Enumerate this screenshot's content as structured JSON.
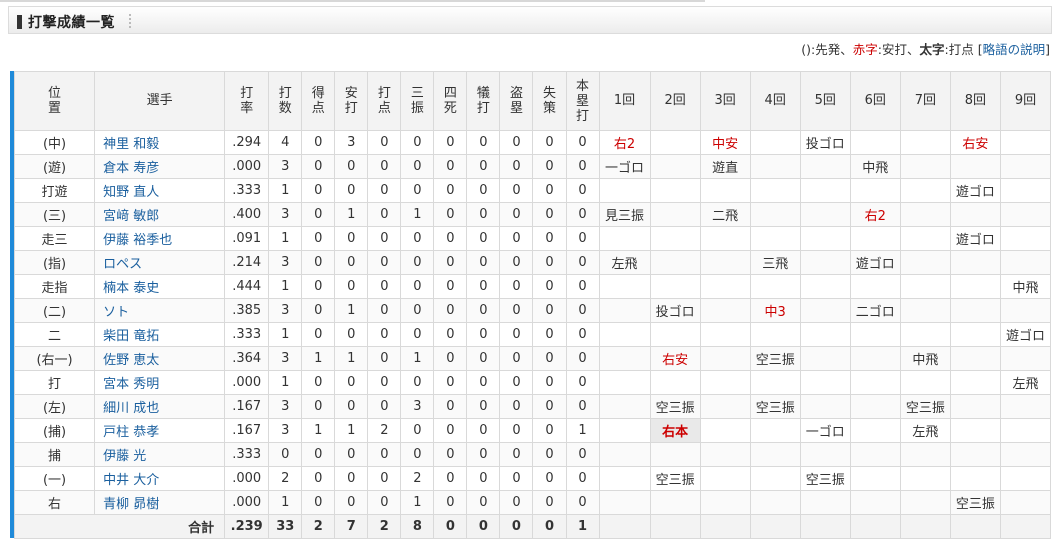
{
  "page": {
    "title": "打撃成績一覧",
    "legend": {
      "part1": "():先発、",
      "red": "赤字",
      "part2": ":安打、",
      "bold": "太字",
      "part3": ":打点 ",
      "bracket_open": "[",
      "link": "略語の説明",
      "bracket_close": "]"
    }
  },
  "colors": {
    "accent": "#1f8ad9",
    "hit": "#cc0000",
    "link": "#1a5f9e"
  },
  "table": {
    "headers": {
      "pos": [
        "位",
        "置"
      ],
      "player": "選手",
      "avg": [
        "打",
        "率"
      ],
      "ab": [
        "打",
        "数"
      ],
      "runs": [
        "得",
        "点"
      ],
      "hits": [
        "安",
        "打"
      ],
      "rbi": [
        "打",
        "点"
      ],
      "so": [
        "三",
        "振"
      ],
      "bb": [
        "四",
        "死"
      ],
      "sac": [
        "犠",
        "打"
      ],
      "sb": [
        "盗",
        "塁"
      ],
      "err": [
        "失",
        "策"
      ],
      "hr": [
        "本",
        "塁",
        "打"
      ],
      "innings": [
        "1回",
        "2回",
        "3回",
        "4回",
        "5回",
        "6回",
        "7回",
        "8回",
        "9回"
      ]
    },
    "rows": [
      {
        "pos": "(中)",
        "name": "神里 和毅",
        "avg": ".294",
        "ab": "4",
        "r": "0",
        "h": "3",
        "rbi": "0",
        "so": "0",
        "bb": "0",
        "sac": "0",
        "sb": "0",
        "e": "0",
        "hr": "0",
        "inn": [
          {
            "t": "右2",
            "k": "hit"
          },
          {
            "t": "",
            "k": ""
          },
          {
            "t": "中安",
            "k": "hit"
          },
          {
            "t": "",
            "k": ""
          },
          {
            "t": "投ゴロ",
            "k": ""
          },
          {
            "t": "",
            "k": ""
          },
          {
            "t": "",
            "k": ""
          },
          {
            "t": "右安",
            "k": "hit"
          },
          {
            "t": "",
            "k": ""
          }
        ]
      },
      {
        "pos": "(遊)",
        "name": "倉本 寿彦",
        "avg": ".000",
        "ab": "3",
        "r": "0",
        "h": "0",
        "rbi": "0",
        "so": "0",
        "bb": "0",
        "sac": "0",
        "sb": "0",
        "e": "0",
        "hr": "0",
        "inn": [
          {
            "t": "一ゴロ",
            "k": ""
          },
          {
            "t": "",
            "k": ""
          },
          {
            "t": "遊直",
            "k": ""
          },
          {
            "t": "",
            "k": ""
          },
          {
            "t": "",
            "k": ""
          },
          {
            "t": "中飛",
            "k": ""
          },
          {
            "t": "",
            "k": ""
          },
          {
            "t": "",
            "k": ""
          },
          {
            "t": "",
            "k": ""
          }
        ]
      },
      {
        "pos": "打遊",
        "name": "知野 直人",
        "avg": ".333",
        "ab": "1",
        "r": "0",
        "h": "0",
        "rbi": "0",
        "so": "0",
        "bb": "0",
        "sac": "0",
        "sb": "0",
        "e": "0",
        "hr": "0",
        "inn": [
          {
            "t": "",
            "k": ""
          },
          {
            "t": "",
            "k": ""
          },
          {
            "t": "",
            "k": ""
          },
          {
            "t": "",
            "k": ""
          },
          {
            "t": "",
            "k": ""
          },
          {
            "t": "",
            "k": ""
          },
          {
            "t": "",
            "k": ""
          },
          {
            "t": "遊ゴロ",
            "k": ""
          },
          {
            "t": "",
            "k": ""
          }
        ]
      },
      {
        "pos": "(三)",
        "name": "宮﨑 敏郎",
        "avg": ".400",
        "ab": "3",
        "r": "0",
        "h": "1",
        "rbi": "0",
        "so": "1",
        "bb": "0",
        "sac": "0",
        "sb": "0",
        "e": "0",
        "hr": "0",
        "inn": [
          {
            "t": "見三振",
            "k": ""
          },
          {
            "t": "",
            "k": ""
          },
          {
            "t": "二飛",
            "k": ""
          },
          {
            "t": "",
            "k": ""
          },
          {
            "t": "",
            "k": ""
          },
          {
            "t": "右2",
            "k": "hit"
          },
          {
            "t": "",
            "k": ""
          },
          {
            "t": "",
            "k": ""
          },
          {
            "t": "",
            "k": ""
          }
        ]
      },
      {
        "pos": "走三",
        "name": "伊藤 裕季也",
        "avg": ".091",
        "ab": "1",
        "r": "0",
        "h": "0",
        "rbi": "0",
        "so": "0",
        "bb": "0",
        "sac": "0",
        "sb": "0",
        "e": "0",
        "hr": "0",
        "inn": [
          {
            "t": "",
            "k": ""
          },
          {
            "t": "",
            "k": ""
          },
          {
            "t": "",
            "k": ""
          },
          {
            "t": "",
            "k": ""
          },
          {
            "t": "",
            "k": ""
          },
          {
            "t": "",
            "k": ""
          },
          {
            "t": "",
            "k": ""
          },
          {
            "t": "遊ゴロ",
            "k": ""
          },
          {
            "t": "",
            "k": ""
          }
        ]
      },
      {
        "pos": "(指)",
        "name": "ロペス",
        "avg": ".214",
        "ab": "3",
        "r": "0",
        "h": "0",
        "rbi": "0",
        "so": "0",
        "bb": "0",
        "sac": "0",
        "sb": "0",
        "e": "0",
        "hr": "0",
        "inn": [
          {
            "t": "左飛",
            "k": ""
          },
          {
            "t": "",
            "k": ""
          },
          {
            "t": "",
            "k": ""
          },
          {
            "t": "三飛",
            "k": ""
          },
          {
            "t": "",
            "k": ""
          },
          {
            "t": "遊ゴロ",
            "k": ""
          },
          {
            "t": "",
            "k": ""
          },
          {
            "t": "",
            "k": ""
          },
          {
            "t": "",
            "k": ""
          }
        ]
      },
      {
        "pos": "走指",
        "name": "楠本 泰史",
        "avg": ".444",
        "ab": "1",
        "r": "0",
        "h": "0",
        "rbi": "0",
        "so": "0",
        "bb": "0",
        "sac": "0",
        "sb": "0",
        "e": "0",
        "hr": "0",
        "inn": [
          {
            "t": "",
            "k": ""
          },
          {
            "t": "",
            "k": ""
          },
          {
            "t": "",
            "k": ""
          },
          {
            "t": "",
            "k": ""
          },
          {
            "t": "",
            "k": ""
          },
          {
            "t": "",
            "k": ""
          },
          {
            "t": "",
            "k": ""
          },
          {
            "t": "",
            "k": ""
          },
          {
            "t": "中飛",
            "k": ""
          }
        ]
      },
      {
        "pos": "(二)",
        "name": "ソト",
        "avg": ".385",
        "ab": "3",
        "r": "0",
        "h": "1",
        "rbi": "0",
        "so": "0",
        "bb": "0",
        "sac": "0",
        "sb": "0",
        "e": "0",
        "hr": "0",
        "inn": [
          {
            "t": "",
            "k": ""
          },
          {
            "t": "投ゴロ",
            "k": ""
          },
          {
            "t": "",
            "k": ""
          },
          {
            "t": "中3",
            "k": "hit"
          },
          {
            "t": "",
            "k": ""
          },
          {
            "t": "二ゴロ",
            "k": ""
          },
          {
            "t": "",
            "k": ""
          },
          {
            "t": "",
            "k": ""
          },
          {
            "t": "",
            "k": ""
          }
        ]
      },
      {
        "pos": "二",
        "name": "柴田 竜拓",
        "avg": ".333",
        "ab": "1",
        "r": "0",
        "h": "0",
        "rbi": "0",
        "so": "0",
        "bb": "0",
        "sac": "0",
        "sb": "0",
        "e": "0",
        "hr": "0",
        "inn": [
          {
            "t": "",
            "k": ""
          },
          {
            "t": "",
            "k": ""
          },
          {
            "t": "",
            "k": ""
          },
          {
            "t": "",
            "k": ""
          },
          {
            "t": "",
            "k": ""
          },
          {
            "t": "",
            "k": ""
          },
          {
            "t": "",
            "k": ""
          },
          {
            "t": "",
            "k": ""
          },
          {
            "t": "遊ゴロ",
            "k": ""
          }
        ]
      },
      {
        "pos": "(右一)",
        "name": "佐野 恵太",
        "avg": ".364",
        "ab": "3",
        "r": "1",
        "h": "1",
        "rbi": "0",
        "so": "1",
        "bb": "0",
        "sac": "0",
        "sb": "0",
        "e": "0",
        "hr": "0",
        "inn": [
          {
            "t": "",
            "k": ""
          },
          {
            "t": "右安",
            "k": "hit"
          },
          {
            "t": "",
            "k": ""
          },
          {
            "t": "空三振",
            "k": ""
          },
          {
            "t": "",
            "k": ""
          },
          {
            "t": "",
            "k": ""
          },
          {
            "t": "中飛",
            "k": ""
          },
          {
            "t": "",
            "k": ""
          },
          {
            "t": "",
            "k": ""
          }
        ]
      },
      {
        "pos": "打",
        "name": "宮本 秀明",
        "avg": ".000",
        "ab": "1",
        "r": "0",
        "h": "0",
        "rbi": "0",
        "so": "0",
        "bb": "0",
        "sac": "0",
        "sb": "0",
        "e": "0",
        "hr": "0",
        "inn": [
          {
            "t": "",
            "k": ""
          },
          {
            "t": "",
            "k": ""
          },
          {
            "t": "",
            "k": ""
          },
          {
            "t": "",
            "k": ""
          },
          {
            "t": "",
            "k": ""
          },
          {
            "t": "",
            "k": ""
          },
          {
            "t": "",
            "k": ""
          },
          {
            "t": "",
            "k": ""
          },
          {
            "t": "左飛",
            "k": ""
          }
        ]
      },
      {
        "pos": "(左)",
        "name": "細川 成也",
        "avg": ".167",
        "ab": "3",
        "r": "0",
        "h": "0",
        "rbi": "0",
        "so": "3",
        "bb": "0",
        "sac": "0",
        "sb": "0",
        "e": "0",
        "hr": "0",
        "inn": [
          {
            "t": "",
            "k": ""
          },
          {
            "t": "空三振",
            "k": ""
          },
          {
            "t": "",
            "k": ""
          },
          {
            "t": "空三振",
            "k": ""
          },
          {
            "t": "",
            "k": ""
          },
          {
            "t": "",
            "k": ""
          },
          {
            "t": "空三振",
            "k": ""
          },
          {
            "t": "",
            "k": ""
          },
          {
            "t": "",
            "k": ""
          }
        ]
      },
      {
        "pos": "(捕)",
        "name": "戸柱 恭孝",
        "avg": ".167",
        "ab": "3",
        "r": "1",
        "h": "1",
        "rbi": "2",
        "so": "0",
        "bb": "0",
        "sac": "0",
        "sb": "0",
        "e": "0",
        "hr": "1",
        "inn": [
          {
            "t": "",
            "k": ""
          },
          {
            "t": "右本",
            "k": "hr"
          },
          {
            "t": "",
            "k": ""
          },
          {
            "t": "",
            "k": ""
          },
          {
            "t": "一ゴロ",
            "k": ""
          },
          {
            "t": "",
            "k": ""
          },
          {
            "t": "左飛",
            "k": ""
          },
          {
            "t": "",
            "k": ""
          },
          {
            "t": "",
            "k": ""
          }
        ]
      },
      {
        "pos": "捕",
        "name": "伊藤 光",
        "avg": ".333",
        "ab": "0",
        "r": "0",
        "h": "0",
        "rbi": "0",
        "so": "0",
        "bb": "0",
        "sac": "0",
        "sb": "0",
        "e": "0",
        "hr": "0",
        "inn": [
          {
            "t": "",
            "k": ""
          },
          {
            "t": "",
            "k": ""
          },
          {
            "t": "",
            "k": ""
          },
          {
            "t": "",
            "k": ""
          },
          {
            "t": "",
            "k": ""
          },
          {
            "t": "",
            "k": ""
          },
          {
            "t": "",
            "k": ""
          },
          {
            "t": "",
            "k": ""
          },
          {
            "t": "",
            "k": ""
          }
        ]
      },
      {
        "pos": "(一)",
        "name": "中井 大介",
        "avg": ".000",
        "ab": "2",
        "r": "0",
        "h": "0",
        "rbi": "0",
        "so": "2",
        "bb": "0",
        "sac": "0",
        "sb": "0",
        "e": "0",
        "hr": "0",
        "inn": [
          {
            "t": "",
            "k": ""
          },
          {
            "t": "空三振",
            "k": ""
          },
          {
            "t": "",
            "k": ""
          },
          {
            "t": "",
            "k": ""
          },
          {
            "t": "空三振",
            "k": ""
          },
          {
            "t": "",
            "k": ""
          },
          {
            "t": "",
            "k": ""
          },
          {
            "t": "",
            "k": ""
          },
          {
            "t": "",
            "k": ""
          }
        ]
      },
      {
        "pos": "右",
        "name": "青柳 昴樹",
        "avg": ".000",
        "ab": "1",
        "r": "0",
        "h": "0",
        "rbi": "0",
        "so": "1",
        "bb": "0",
        "sac": "0",
        "sb": "0",
        "e": "0",
        "hr": "0",
        "inn": [
          {
            "t": "",
            "k": ""
          },
          {
            "t": "",
            "k": ""
          },
          {
            "t": "",
            "k": ""
          },
          {
            "t": "",
            "k": ""
          },
          {
            "t": "",
            "k": ""
          },
          {
            "t": "",
            "k": ""
          },
          {
            "t": "",
            "k": ""
          },
          {
            "t": "空三振",
            "k": ""
          },
          {
            "t": "",
            "k": ""
          }
        ]
      }
    ],
    "totals": {
      "label": "合計",
      "avg": ".239",
      "ab": "33",
      "r": "2",
      "h": "7",
      "rbi": "2",
      "so": "8",
      "bb": "0",
      "sac": "0",
      "sb": "0",
      "e": "0",
      "hr": "1"
    }
  }
}
